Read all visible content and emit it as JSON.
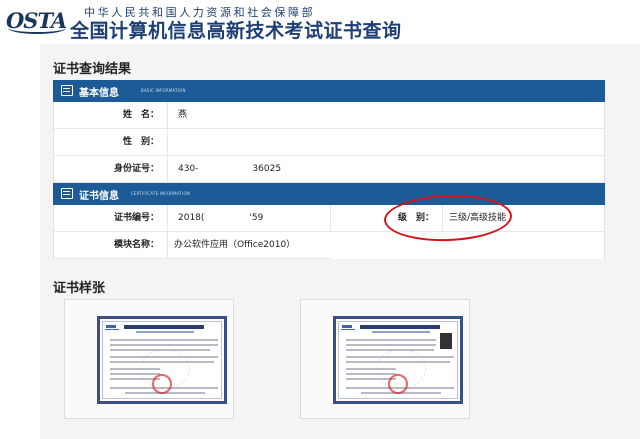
{
  "header": {
    "logo_text": "OSTA",
    "sub_title": "中华人民共和国人力资源和社会保障部",
    "main_title": "全国计算机信息高新技术考试证书查询"
  },
  "result": {
    "section_title": "证书查询结果",
    "basic": {
      "title": "基本信息",
      "en": "BASIC INFORMATION",
      "rows": [
        {
          "label": "姓　名：",
          "value": "燕"
        },
        {
          "label": "性　别：",
          "value": ""
        },
        {
          "label": "身份证号：",
          "value": "430-　　　　　　36025"
        }
      ]
    },
    "cert": {
      "title": "证书信息",
      "en": "CERTIFICATE INFORMATION",
      "number_label": "证书编号：",
      "number_value": "2018(　　　　　'59",
      "level_label": "级　别：",
      "level_value": "三级/高级技能",
      "module_label": "模块名称：",
      "module_value": "办公软件应用（Office2010）"
    }
  },
  "samples": {
    "section_title": "证书样张"
  },
  "colors": {
    "header_blue": "#1c5b96",
    "title_blue": "#1d3f73",
    "annotation_red": "#d3131b"
  }
}
